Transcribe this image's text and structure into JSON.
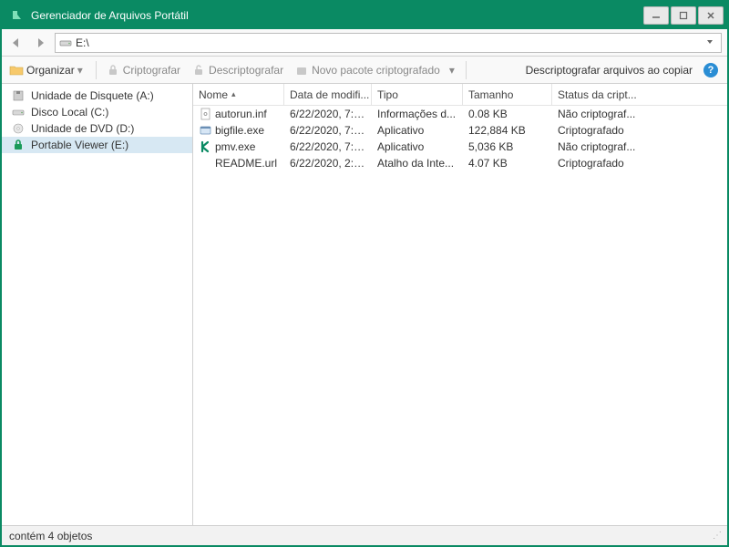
{
  "window": {
    "title": "Gerenciador de Arquivos Portátil"
  },
  "navbar": {
    "path": "E:\\"
  },
  "toolbar": {
    "organize": "Organizar",
    "encrypt": "Criptografar",
    "decrypt": "Descriptografar",
    "newpkg": "Novo pacote criptografado",
    "decrypt_on_copy": "Descriptografar arquivos ao copiar"
  },
  "tree": {
    "items": [
      {
        "label": "Unidade de Disquete (A:)",
        "icon": "floppy"
      },
      {
        "label": "Disco Local (C:)",
        "icon": "drive"
      },
      {
        "label": "Unidade de DVD (D:)",
        "icon": "dvd"
      },
      {
        "label": "Portable Viewer (E:)",
        "icon": "lock",
        "selected": true
      }
    ]
  },
  "list": {
    "columns": {
      "name": "Nome",
      "mod": "Data de modifi...",
      "type": "Tipo",
      "size": "Tamanho",
      "status": "Status da cript..."
    },
    "rows": [
      {
        "icon": "inf",
        "name": "autorun.inf",
        "mod": "6/22/2020, 7:5...",
        "type": "Informações d...",
        "size": "0.08 KB",
        "status": "Não criptograf..."
      },
      {
        "icon": "exe",
        "name": "bigfile.exe",
        "mod": "6/22/2020, 7:5...",
        "type": "Aplicativo",
        "size": "122,884 KB",
        "status": "Criptografado"
      },
      {
        "icon": "kexe",
        "name": "pmv.exe",
        "mod": "6/22/2020, 7:5...",
        "type": "Aplicativo",
        "size": "5,036 KB",
        "status": "Não criptograf..."
      },
      {
        "icon": "url",
        "name": "README.url",
        "mod": "6/22/2020, 2:4...",
        "type": "Atalho da Inte...",
        "size": "4.07 KB",
        "status": "Criptografado"
      }
    ]
  },
  "status": {
    "text": "contém 4 objetos"
  }
}
